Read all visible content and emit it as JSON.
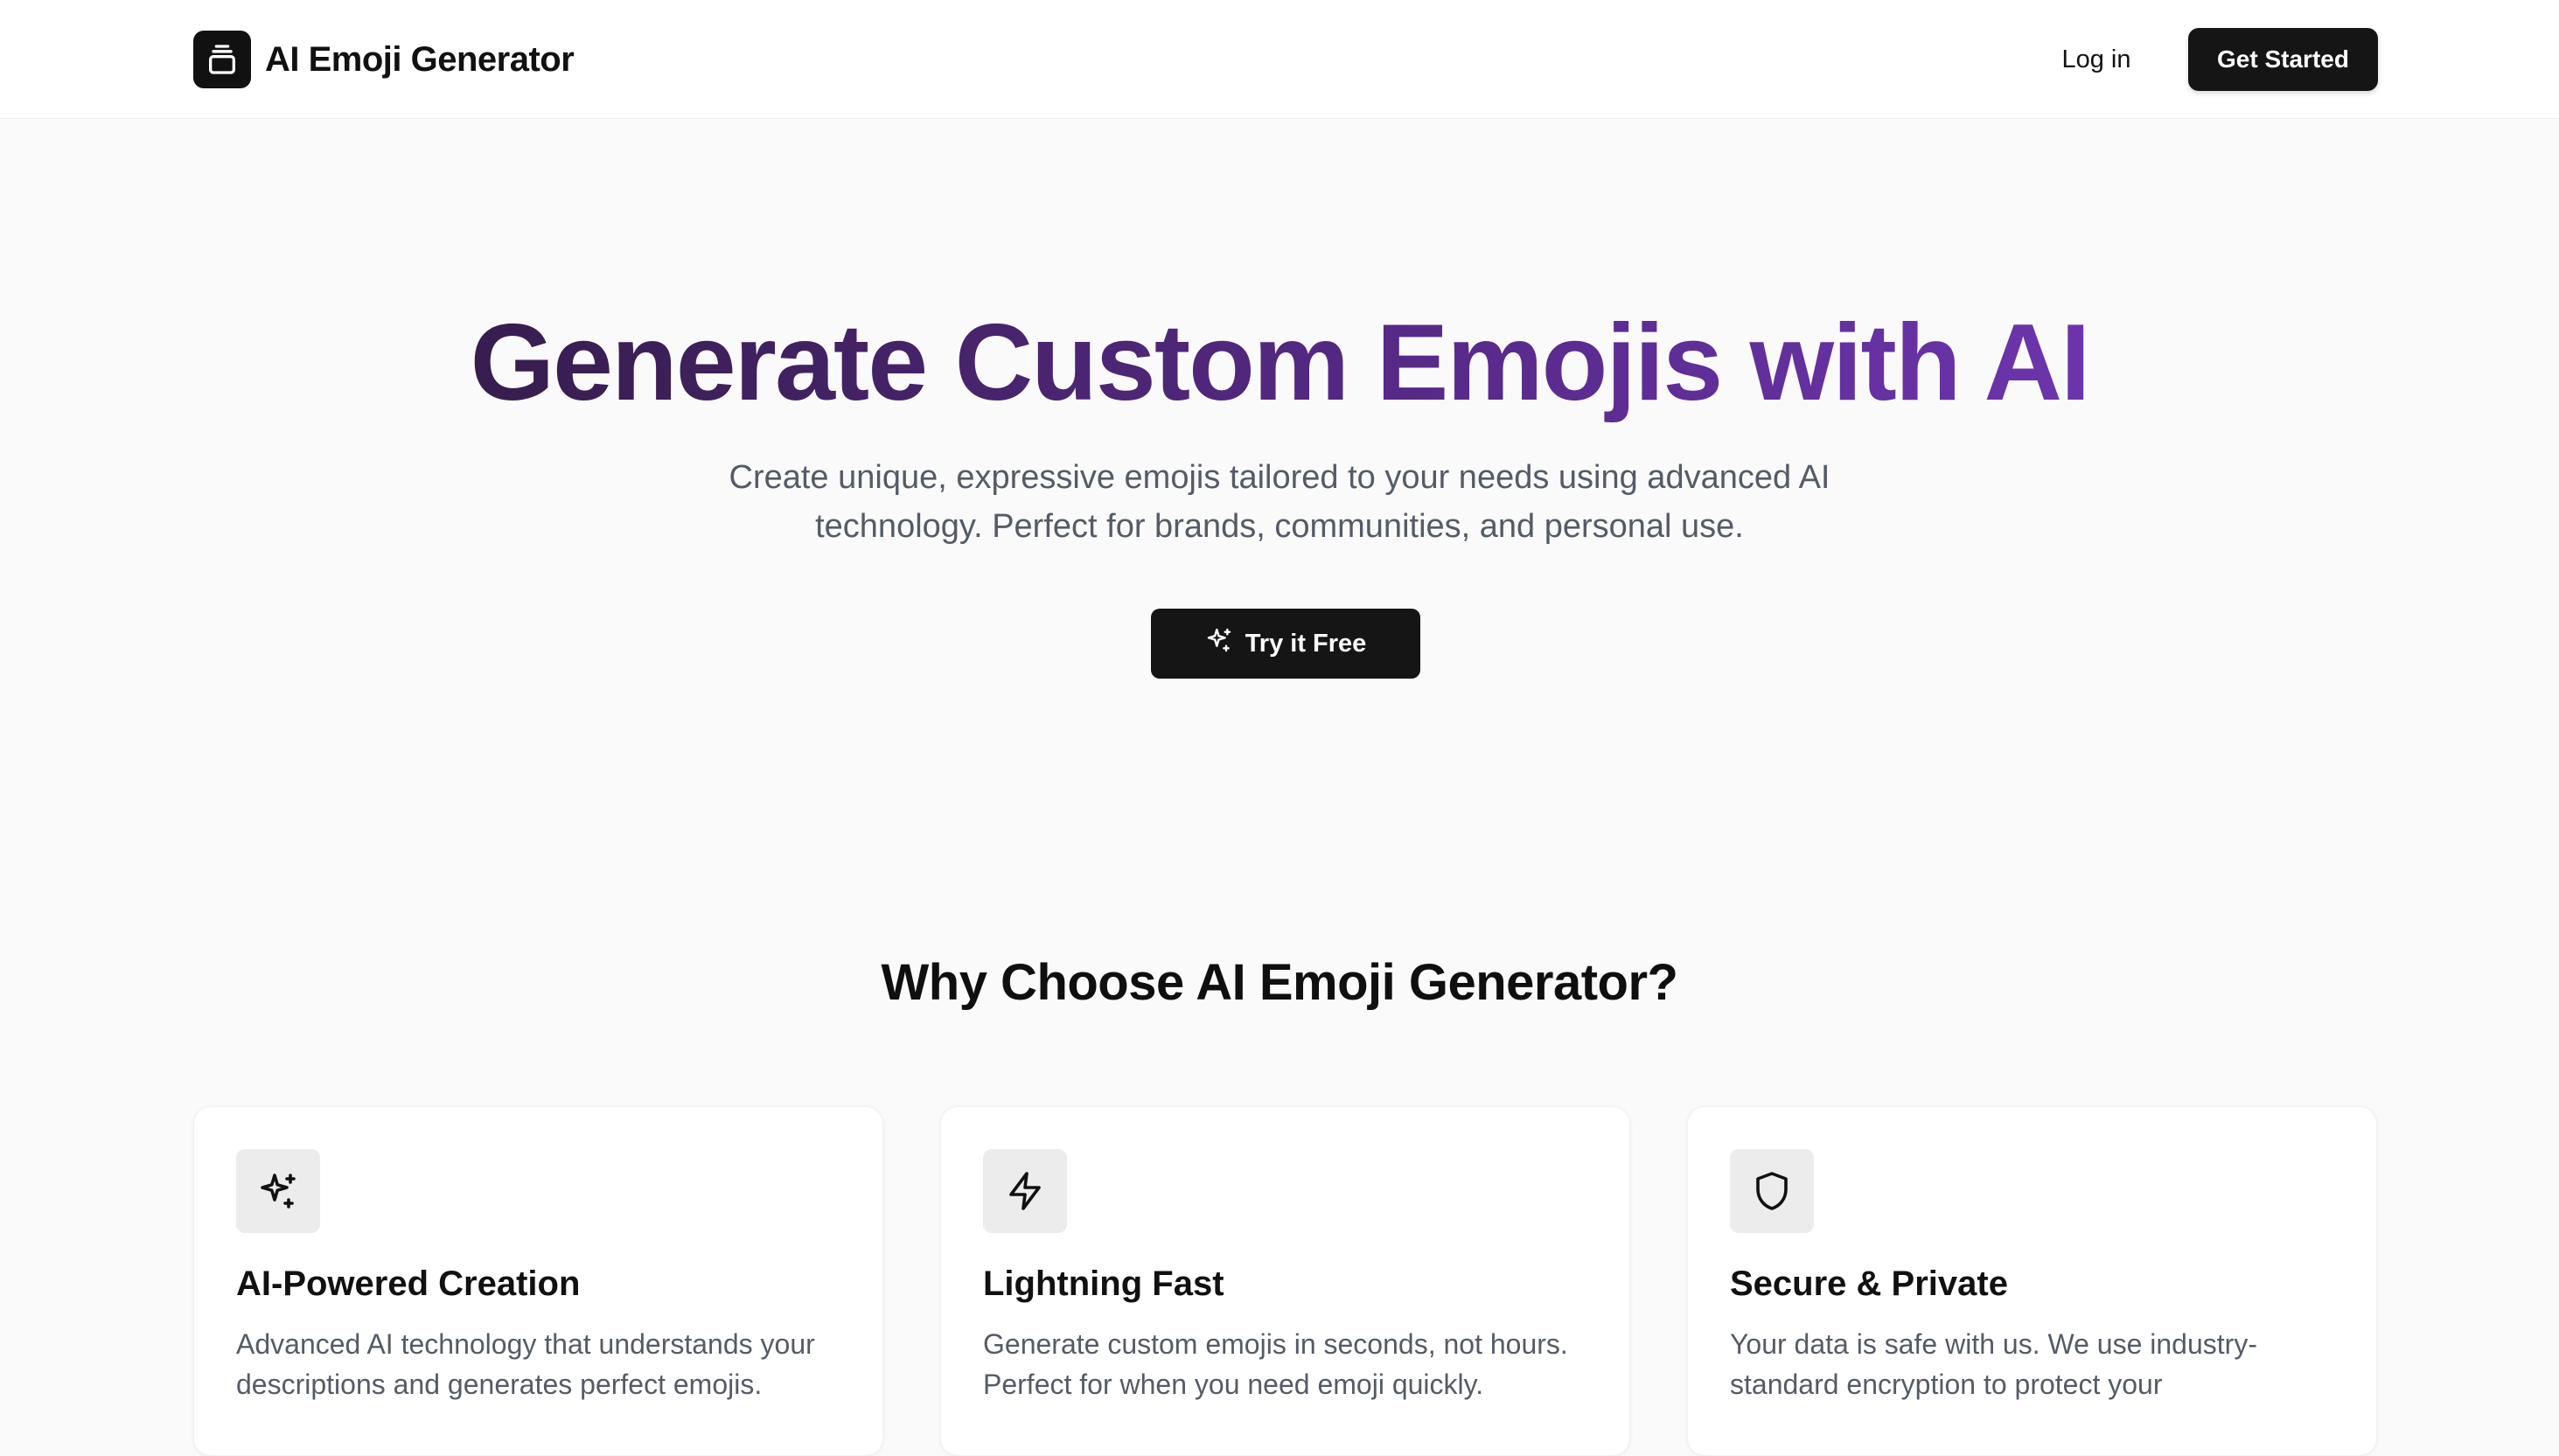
{
  "header": {
    "brand": "AI Emoji Generator",
    "logo_icon": "stack-icon",
    "login_label": "Log in",
    "get_started_label": "Get Started"
  },
  "hero": {
    "title_part1": "Generate Custom",
    "title_part2": "Emojis with AI",
    "subtitle": "Create unique, expressive emojis tailored to your needs using advanced AI technology. Perfect for brands, communities, and personal use.",
    "cta_label": "Try it Free",
    "cta_icon": "sparkles-icon"
  },
  "features": {
    "heading": "Why Choose AI Emoji Generator?",
    "items": [
      {
        "icon": "sparkles-icon",
        "title": "AI-Powered Creation",
        "description": "Advanced AI technology that understands your descriptions and generates perfect emojis."
      },
      {
        "icon": "lightning-icon",
        "title": "Lightning Fast",
        "description": "Generate custom emojis in seconds, not hours. Perfect for when you need emoji quickly."
      },
      {
        "icon": "shield-icon",
        "title": "Secure & Private",
        "description": "Your data is safe with us. We use industry-standard encryption to protect your"
      }
    ]
  },
  "colors": {
    "primary_button": "#151515",
    "gradient_start": "#2a1638",
    "gradient_end": "#7c3cc4",
    "muted_text": "#555b66"
  }
}
